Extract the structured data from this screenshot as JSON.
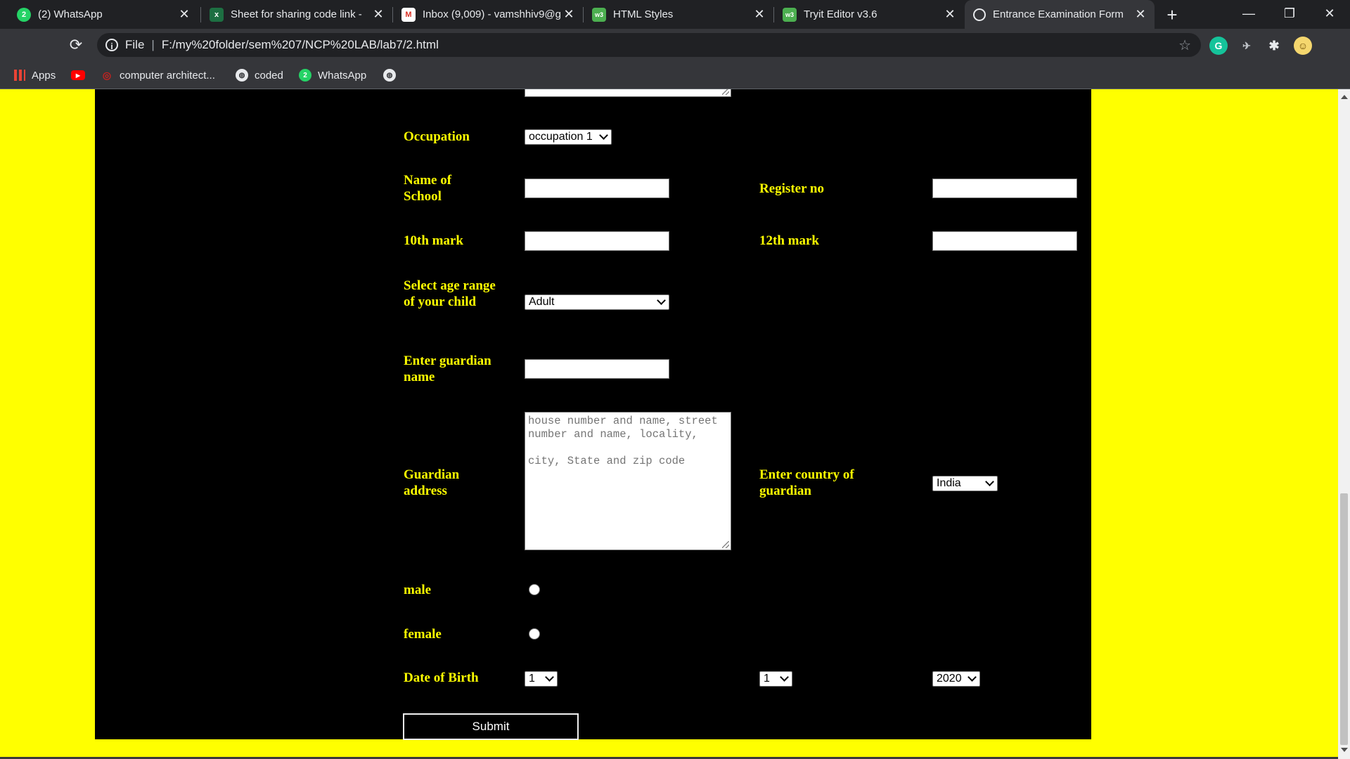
{
  "browser": {
    "tabs": [
      {
        "title": "(2) WhatsApp",
        "icon": "whatsapp-icon",
        "icon_color": "#25d366",
        "icon_glyph": "2"
      },
      {
        "title": "Sheet for sharing code link - ",
        "icon": "excel-icon",
        "icon_color": "#1d6f42",
        "icon_glyph": "x"
      },
      {
        "title": "Inbox (9,009) - vamshhiv9@g",
        "icon": "gmail-icon",
        "icon_color": "#d93025",
        "icon_glyph": "M"
      },
      {
        "title": "HTML Styles",
        "icon": "w3schools-icon",
        "icon_color": "#4caf50",
        "icon_glyph": "w3"
      },
      {
        "title": "Tryit Editor v3.6",
        "icon": "w3schools-icon",
        "icon_color": "#4caf50",
        "icon_glyph": "w3"
      },
      {
        "title": "Entrance Examination Form",
        "icon": "globe-icon",
        "icon_color": "#5f6368",
        "icon_glyph": ""
      }
    ],
    "new_tab": "+",
    "window_controls": {
      "minimize": "—",
      "restore": "❐",
      "close": "✕"
    },
    "address": {
      "scheme": "File",
      "url": "F:/my%20folder/sem%207/NCP%20LAB/lab7/2.html"
    },
    "bookmarks": [
      {
        "label": "Apps",
        "icon": "apps-grid-icon"
      },
      {
        "label": "",
        "icon": "youtube-icon"
      },
      {
        "label": "computer architect...",
        "icon": "bookmark-icon"
      },
      {
        "label": "coded",
        "icon": "globe-icon"
      },
      {
        "label": "WhatsApp",
        "icon": "whatsapp-icon"
      },
      {
        "label": "",
        "icon": "globe-icon"
      }
    ]
  },
  "colors": {
    "page_bg": "#ffff00",
    "panel_bg": "#000000",
    "label_color": "#ffff00"
  },
  "form": {
    "occupation": {
      "label": "Occupation",
      "selected": "occupation 1"
    },
    "school_name": {
      "label": "Name of School",
      "value": ""
    },
    "register_no": {
      "label": "Register no",
      "value": ""
    },
    "mark_10th": {
      "label": "10th mark",
      "value": ""
    },
    "mark_12th": {
      "label": "12th mark",
      "value": ""
    },
    "age_range": {
      "label": "Select age range of your child",
      "selected": "Adult"
    },
    "guardian_name": {
      "label": "Enter guardian name",
      "value": ""
    },
    "guardian_address": {
      "label": "Guardian address",
      "placeholder": "house number and name, street number and name, locality,\n\ncity, State and zip code"
    },
    "guardian_country": {
      "label": "Enter country of guardian",
      "selected": "India"
    },
    "gender_male": {
      "label": "male"
    },
    "gender_female": {
      "label": "female"
    },
    "dob": {
      "label": "Date of Birth",
      "day": "1",
      "month": "1",
      "year": "2020"
    },
    "submit_label": "Submit"
  }
}
